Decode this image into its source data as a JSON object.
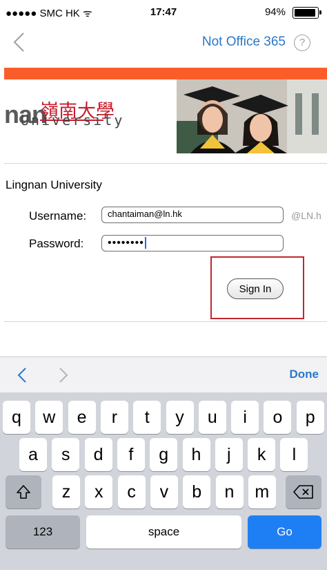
{
  "status_bar": {
    "carrier": "●●●●● SMC HK ᯤ",
    "time": "17:47",
    "battery": "94%"
  },
  "nav": {
    "title": "Not Office 365",
    "help_glyph": "?"
  },
  "banner": {
    "logo_word": "nan",
    "logo_chinese": "嶺南大學",
    "logo_sub": "University"
  },
  "form": {
    "heading": "Lingnan University",
    "username_label": "Username:",
    "username_value": "chantaiman@ln.hk",
    "domain_suffix": "@LN.h",
    "password_label": "Password:",
    "password_masked": "••••••••",
    "signin_label": "Sign In"
  },
  "toolbar": {
    "done_label": "Done"
  },
  "keyboard": {
    "row1": [
      "q",
      "w",
      "e",
      "r",
      "t",
      "y",
      "u",
      "i",
      "o",
      "p"
    ],
    "row2": [
      "a",
      "s",
      "d",
      "f",
      "g",
      "h",
      "j",
      "k",
      "l"
    ],
    "row3": [
      "z",
      "x",
      "c",
      "v",
      "b",
      "n",
      "m"
    ],
    "numbers_label": "123",
    "space_label": "space",
    "go_label": "Go"
  },
  "colors": {
    "accent": "#2a78c8",
    "banner_orange": "#fa5d2a",
    "highlight_red": "#c0272d",
    "go_blue": "#1e7ff5"
  }
}
